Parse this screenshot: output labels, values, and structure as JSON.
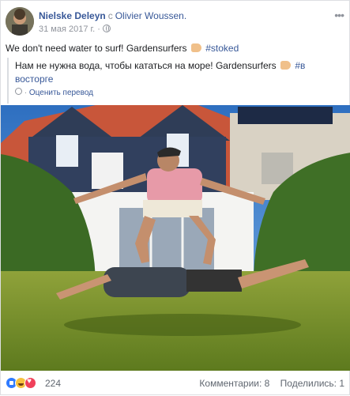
{
  "post": {
    "author": "Nielske Deleyn",
    "with_prefix": "с",
    "with_name": "Olivier Woussen.",
    "date": "31 мая 2017 г.",
    "privacy_icon": "globe-icon",
    "more_icon": "ellipsis-icon",
    "text_main": "We don't need water to surf! Gardensurfers",
    "text_tag": "#stoked",
    "emoji": "flexed-biceps-emoji"
  },
  "translation": {
    "text_main": "Нам не нужна вода, чтобы кататься на море! Gardensurfers",
    "text_tag": "#в восторге",
    "rate_label": "Оценить перевод"
  },
  "photo": {
    "description": "photo"
  },
  "footer": {
    "reaction_count": "224",
    "comments": "Комментарии: 8",
    "shares": "Поделились: 1"
  },
  "colors": {
    "link": "#385898",
    "muted": "#90949c",
    "like": "#2f7bff",
    "haha": "#f7c23f",
    "love": "#f0405a"
  }
}
